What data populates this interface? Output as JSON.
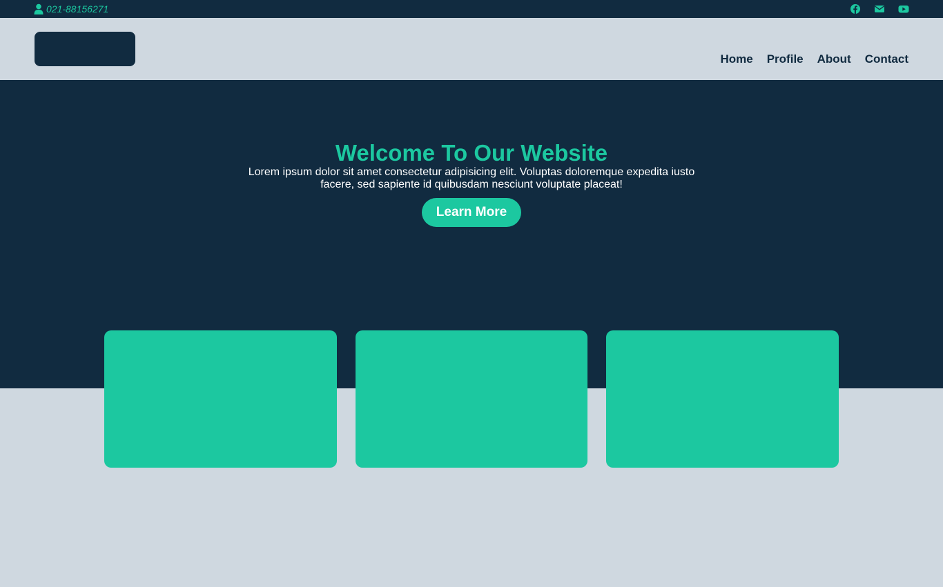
{
  "topbar": {
    "phone": "021-88156271",
    "icons": [
      "user-icon",
      "facebook-icon",
      "envelope-icon",
      "youtube-icon"
    ]
  },
  "nav": {
    "items": [
      {
        "label": "Home"
      },
      {
        "label": "Profile"
      },
      {
        "label": "About"
      },
      {
        "label": "Contact"
      }
    ]
  },
  "hero": {
    "title": "Welcome To Our Website",
    "text": "Lorem ipsum dolor sit amet consectetur adipisicing elit. Voluptas doloremque expedita iusto facere, sed sapiente id quibusdam nesciunt voluptate placeat!",
    "button_label": "Learn More"
  },
  "colors": {
    "dark": "#112b40",
    "accent": "#1cc8a0",
    "light": "#cfd8e0"
  }
}
